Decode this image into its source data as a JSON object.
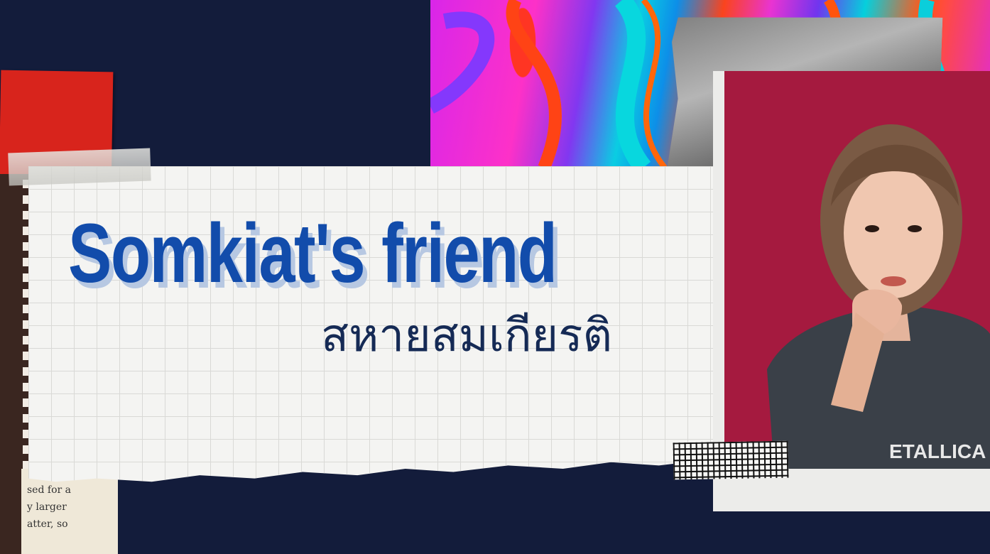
{
  "title": "Somkiat's friend",
  "subtitle": "สหายสมเกียรติ",
  "book_lines": [
    "sed for a",
    "y larger",
    "atter, so"
  ],
  "shirt_text": "ETALLICA",
  "colors": {
    "background": "#131c3b",
    "title": "#124cab",
    "subtitle": "#152a55",
    "photo_backdrop": "#a51a3f",
    "red_block": "#d8241c"
  }
}
